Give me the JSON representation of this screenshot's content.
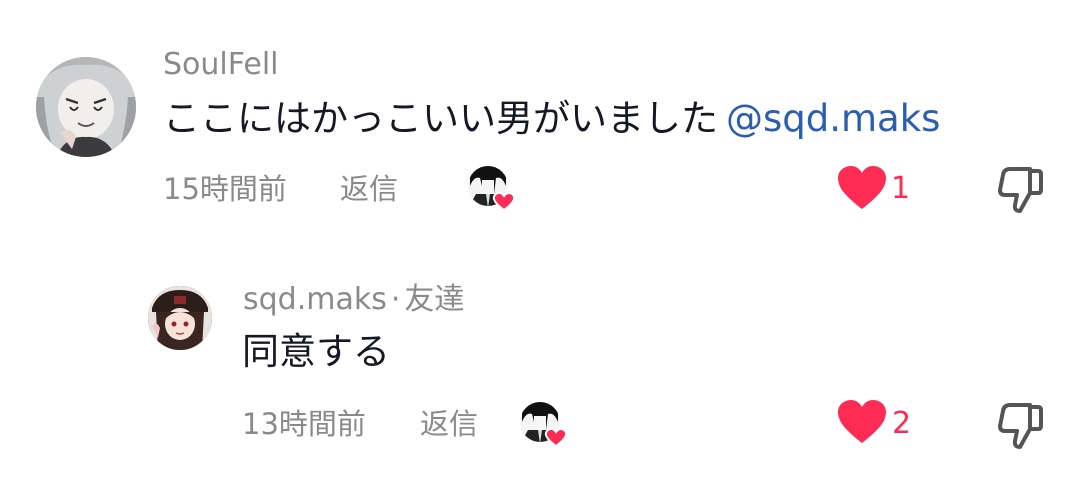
{
  "colors": {
    "text": "#161823",
    "secondary": "#8a8a8a",
    "mention": "#2b5eae",
    "like": "#fe2c55"
  },
  "comments": [
    {
      "author": "SoulFell",
      "text": "ここにはかっこいい男がいました",
      "mention": "@sqd.maks",
      "time": "15時間前",
      "reply_label": "返信",
      "liked_by_creator": true,
      "liked": true,
      "like_count": "1",
      "icons": [
        "avatar",
        "creator-liked-icon",
        "heart-icon",
        "thumbs-down-icon"
      ]
    },
    {
      "author": "sqd.maks",
      "separator": "·",
      "badge": "友達",
      "text": "同意する",
      "time": "13時間前",
      "reply_label": "返信",
      "liked_by_creator": true,
      "liked": true,
      "like_count": "2",
      "icons": [
        "avatar",
        "creator-liked-icon",
        "heart-icon",
        "thumbs-down-icon"
      ]
    }
  ]
}
